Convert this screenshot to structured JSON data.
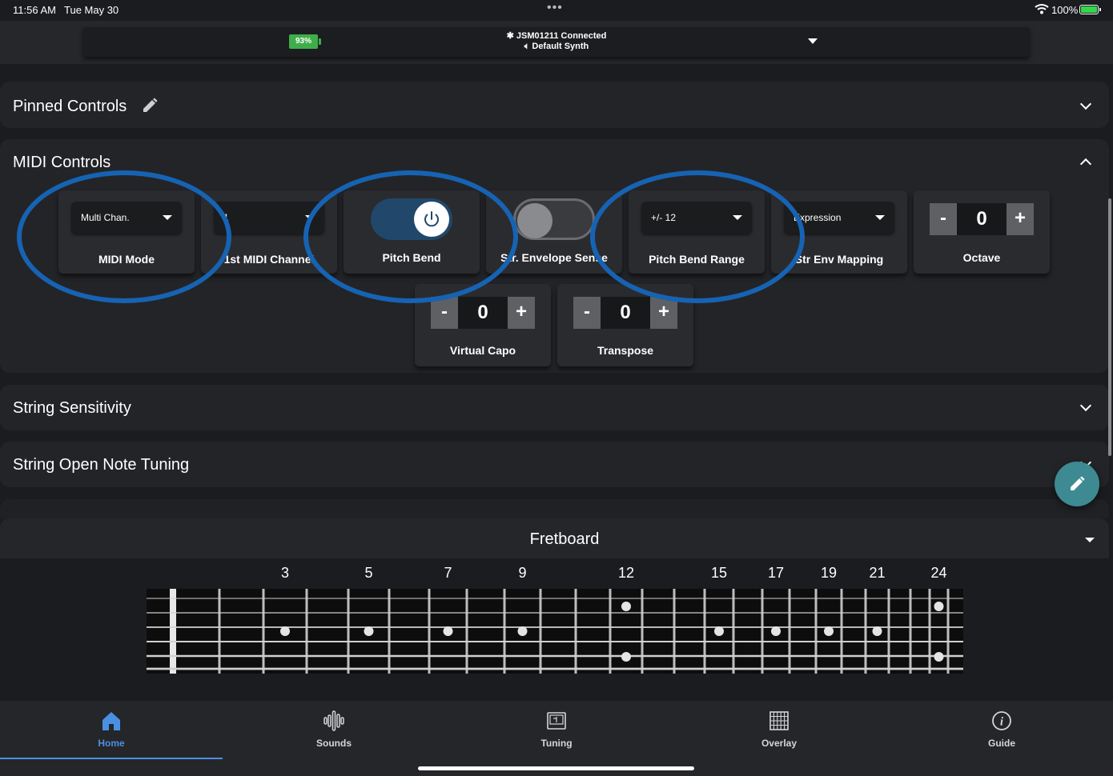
{
  "status_bar": {
    "time": "11:56 AM",
    "date": "Tue May 30",
    "battery_percent": "100%"
  },
  "header": {
    "device_battery": "93%",
    "device_name": "JSM01211  Connected",
    "synth_name": "Default Synth"
  },
  "sections": {
    "pinned": "Pinned Controls",
    "midi": "MIDI Controls",
    "string_sensitivity": "String Sensitivity",
    "open_note_tuning": "String Open Note Tuning",
    "fretboard": "Fretboard"
  },
  "midi_controls": {
    "midi_mode": {
      "value": "Multi Chan.",
      "label": "MIDI Mode"
    },
    "first_channel": {
      "value": "1",
      "label": "1st MIDI Channel"
    },
    "pitch_bend": {
      "label": "Pitch Bend",
      "state": "on"
    },
    "env_sense": {
      "label": "Str. Envelope Sense",
      "state": "off"
    },
    "pitch_bend_range": {
      "value": "+/- 12",
      "label": "Pitch Bend Range"
    },
    "env_mapping": {
      "value": "Expression",
      "label": "Str Env Mapping"
    },
    "octave": {
      "value": "0",
      "label": "Octave",
      "minus": "-",
      "plus": "+"
    },
    "virtual_capo": {
      "value": "0",
      "label": "Virtual Capo",
      "minus": "-",
      "plus": "+"
    },
    "transpose": {
      "value": "0",
      "label": "Transpose",
      "minus": "-",
      "plus": "+"
    }
  },
  "fretboard": {
    "marker_labels": [
      "3",
      "5",
      "7",
      "9",
      "12",
      "15",
      "17",
      "19",
      "21",
      "24"
    ],
    "single_dot_frets": [
      3,
      5,
      7,
      9,
      15,
      17,
      19,
      21
    ],
    "double_dot_frets": [
      12,
      24
    ]
  },
  "bottom_nav": [
    {
      "label": "Home",
      "icon": "home-icon",
      "active": true
    },
    {
      "label": "Sounds",
      "icon": "waveform-icon",
      "active": false
    },
    {
      "label": "Tuning",
      "icon": "tuner-icon",
      "active": false
    },
    {
      "label": "Overlay",
      "icon": "grid-icon",
      "active": false
    },
    {
      "label": "Guide",
      "icon": "info-icon",
      "active": false
    }
  ],
  "colors": {
    "accent": "#4a90e2",
    "annotation": "#1663b3",
    "toggle_on": "#21476a",
    "fab": "#3d8a93",
    "battery": "#3fae4a"
  }
}
